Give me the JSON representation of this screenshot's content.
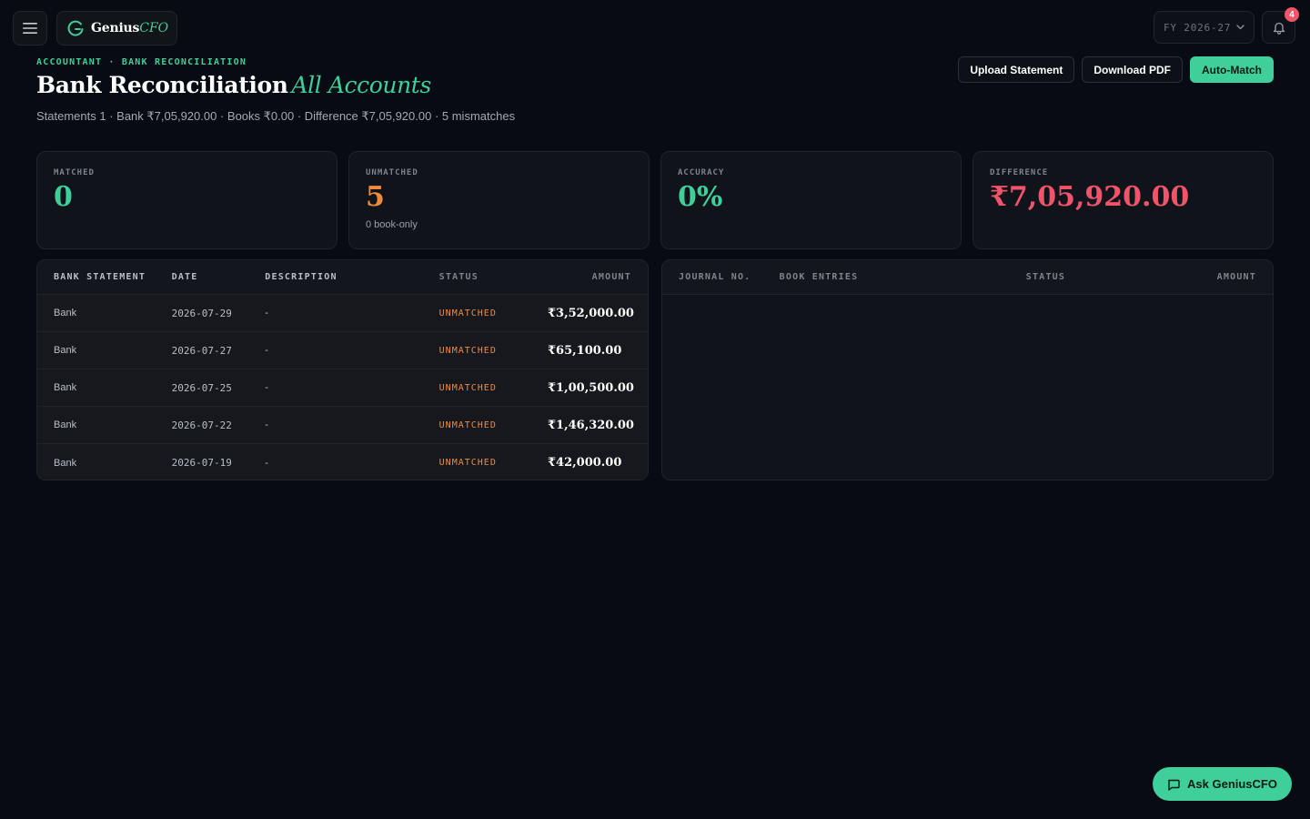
{
  "topbar": {
    "brand_name": "Genius",
    "brand_accent": "CFO",
    "fy_label": "FY 2026-27",
    "notification_count": "4"
  },
  "header": {
    "breadcrumb": "ACCOUNTANT · BANK RECONCILIATION",
    "title": "Bank Reconciliation",
    "title_accent": "All Accounts",
    "summary": "Statements 1 · Bank ₹7,05,920.00 · Books ₹0.00 · Difference ₹7,05,920.00 · 5 mismatches"
  },
  "actions": {
    "upload": "Upload Statement",
    "download": "Download PDF",
    "auto_match": "Auto-Match"
  },
  "stats": {
    "matched": {
      "label": "MATCHED",
      "value": "0",
      "color": "#3ecf9a"
    },
    "unmatched": {
      "label": "UNMATCHED",
      "value": "5",
      "sub": "0 book-only",
      "color": "#f08a3c"
    },
    "accuracy": {
      "label": "ACCURACY",
      "value": "0%",
      "color": "#3ecf9a"
    },
    "difference": {
      "label": "DIFFERENCE",
      "value": "₹7,05,920.00",
      "color": "#f0546a"
    }
  },
  "bank_table": {
    "headers": {
      "source": "BANK STATEMENT",
      "date": "DATE",
      "description": "DESCRIPTION",
      "status": "STATUS",
      "amount": "AMOUNT"
    },
    "rows": [
      {
        "source": "Bank",
        "date": "2026-07-29",
        "description": "-",
        "status": "UNMATCHED",
        "amount": "₹3,52,000.00"
      },
      {
        "source": "Bank",
        "date": "2026-07-27",
        "description": "-",
        "status": "UNMATCHED",
        "amount": "₹65,100.00"
      },
      {
        "source": "Bank",
        "date": "2026-07-25",
        "description": "-",
        "status": "UNMATCHED",
        "amount": "₹1,00,500.00"
      },
      {
        "source": "Bank",
        "date": "2026-07-22",
        "description": "-",
        "status": "UNMATCHED",
        "amount": "₹1,46,320.00"
      },
      {
        "source": "Bank",
        "date": "2026-07-19",
        "description": "-",
        "status": "UNMATCHED",
        "amount": "₹42,000.00"
      }
    ]
  },
  "book_table": {
    "headers": {
      "journal": "JOURNAL NO.",
      "entries": "BOOK ENTRIES",
      "status": "STATUS",
      "amount": "AMOUNT"
    }
  },
  "assistant": {
    "label": "Ask GeniusCFO"
  }
}
